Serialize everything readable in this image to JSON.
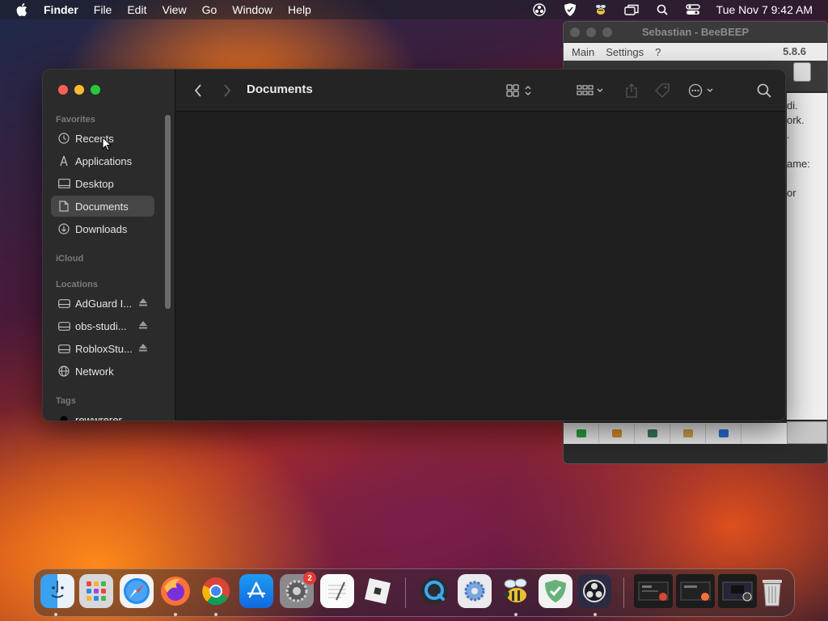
{
  "menubar": {
    "app_name": "Finder",
    "items": [
      "File",
      "Edit",
      "View",
      "Go",
      "Window",
      "Help"
    ],
    "clock": "Tue Nov 7  9:42 AM",
    "status_icons": [
      "obs-icon",
      "adguard-icon",
      "beebeep-icon",
      "screen-mirroring-icon",
      "search-icon",
      "control-center-icon"
    ]
  },
  "beebeep": {
    "title": "Sebastian - BeeBEEP",
    "menu": [
      "Main",
      "Settings",
      "?"
    ],
    "version": "5.8.6",
    "content_lines": [
      "di.",
      "ork.",
      ".",
      "",
      "ame:",
      "",
      "or"
    ]
  },
  "finder": {
    "title": "Documents",
    "sidebar": {
      "favorites_header": "Favorites",
      "favorites": [
        {
          "label": "Recents",
          "icon": "clock-icon"
        },
        {
          "label": "Applications",
          "icon": "applications-icon"
        },
        {
          "label": "Desktop",
          "icon": "desktop-icon"
        },
        {
          "label": "Documents",
          "icon": "document-icon",
          "selected": true
        },
        {
          "label": "Downloads",
          "icon": "download-icon"
        }
      ],
      "icloud_header": "iCloud",
      "locations_header": "Locations",
      "locations": [
        {
          "label": "AdGuard I...",
          "icon": "drive-icon",
          "ejectable": true
        },
        {
          "label": "obs-studi...",
          "icon": "drive-icon",
          "ejectable": true
        },
        {
          "label": "RobloxStu...",
          "icon": "drive-icon",
          "ejectable": true
        },
        {
          "label": "Network",
          "icon": "globe-icon"
        }
      ],
      "tags_header": "Tags",
      "tags": [
        {
          "label": "rewwrerer",
          "color": "#000000"
        }
      ]
    }
  },
  "dock": {
    "badge_settings": "2",
    "apps": [
      "Finder",
      "Launchpad",
      "Safari",
      "Firefox",
      "Chrome",
      "App Store",
      "System Settings",
      "TextEdit",
      "Roblox",
      "QuickTime Player",
      "Preferences",
      "BeeBEEP",
      "AdGuard",
      "OBS",
      "Window 1",
      "Window 2",
      "Window 3",
      "Trash"
    ]
  },
  "colors": {
    "close": "#ff5f57",
    "minimize": "#febc2e",
    "zoom": "#28c840",
    "selected_row": "#464646"
  }
}
